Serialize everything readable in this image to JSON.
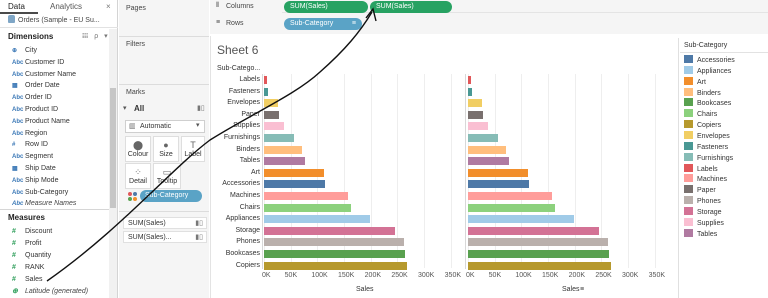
{
  "tabs": {
    "data": "Data",
    "analytics": "Analytics",
    "close": "×"
  },
  "datasource": "Orders (Sample - EU Su...",
  "dimensions": {
    "heading": "Dimensions",
    "tools": "𝍖 ρ ▾",
    "fields": [
      {
        "type": "⊕",
        "name": "City"
      },
      {
        "type": "Abc",
        "name": "Customer ID"
      },
      {
        "type": "Abc",
        "name": "Customer Name"
      },
      {
        "type": "▦",
        "name": "Order Date"
      },
      {
        "type": "Abc",
        "name": "Order ID"
      },
      {
        "type": "Abc",
        "name": "Product ID"
      },
      {
        "type": "Abc",
        "name": "Product Name"
      },
      {
        "type": "Abc",
        "name": "Region"
      },
      {
        "type": "#",
        "name": "Row ID"
      },
      {
        "type": "Abc",
        "name": "Segment"
      },
      {
        "type": "▦",
        "name": "Ship Date"
      },
      {
        "type": "Abc",
        "name": "Ship Mode"
      },
      {
        "type": "Abc",
        "name": "Sub-Category"
      },
      {
        "type": "Abc",
        "name": "Measure Names"
      }
    ]
  },
  "measures": {
    "heading": "Measures",
    "fields": [
      {
        "type": "#",
        "name": "Discount"
      },
      {
        "type": "#",
        "name": "Profit"
      },
      {
        "type": "#",
        "name": "Quantity"
      },
      {
        "type": "#",
        "name": "RANK"
      },
      {
        "type": "#",
        "name": "Sales"
      },
      {
        "type": "⊕",
        "name": "Latitude (generated)"
      }
    ]
  },
  "shelves": {
    "pages": "Pages",
    "filters": "Filters",
    "marks": "Marks",
    "marks_all": "All",
    "mark_type": "Automatic",
    "buttons": {
      "colour": "Colour",
      "size": "Size",
      "label": "Label",
      "detail": "Detail",
      "tooltip": "Tooltip"
    },
    "colour_pill": "Sub-Category",
    "sum_rows": [
      "SUM(Sales)",
      "SUM(Sales)..."
    ],
    "columns_label": "Columns",
    "rows_label": "Rows",
    "column_pills": [
      "SUM(Sales)",
      "SUM(Sales)"
    ],
    "row_pill": "Sub-Category"
  },
  "sheet": {
    "title": "Sheet 6",
    "row_header": "Sub-Catego...",
    "axis_title_left": "Sales",
    "axis_title_right": "Sales",
    "sort_icon": "≡"
  },
  "legend": {
    "title": "Sub-Category",
    "items": [
      {
        "name": "Accessories",
        "color": "#4e79a7"
      },
      {
        "name": "Appliances",
        "color": "#a0cbe8"
      },
      {
        "name": "Art",
        "color": "#f28e2b"
      },
      {
        "name": "Binders",
        "color": "#ffbe7d"
      },
      {
        "name": "Bookcases",
        "color": "#59a14f"
      },
      {
        "name": "Chairs",
        "color": "#8cd17d"
      },
      {
        "name": "Copiers",
        "color": "#b6992d"
      },
      {
        "name": "Envelopes",
        "color": "#f1ce63"
      },
      {
        "name": "Fasteners",
        "color": "#499894"
      },
      {
        "name": "Furnishings",
        "color": "#86bcb6"
      },
      {
        "name": "Labels",
        "color": "#e15759"
      },
      {
        "name": "Machines",
        "color": "#ff9d9a"
      },
      {
        "name": "Paper",
        "color": "#79706e"
      },
      {
        "name": "Phones",
        "color": "#bab0ac"
      },
      {
        "name": "Storage",
        "color": "#d37295"
      },
      {
        "name": "Supplies",
        "color": "#fabfd2"
      },
      {
        "name": "Tables",
        "color": "#b07aa1"
      }
    ]
  },
  "chart_data": {
    "type": "bar",
    "orientation": "horizontal",
    "panels": 2,
    "categories": [
      "Labels",
      "Fasteners",
      "Envelopes",
      "Paper",
      "Supplies",
      "Furnishings",
      "Binders",
      "Tables",
      "Art",
      "Accessories",
      "Machines",
      "Chairs",
      "Appliances",
      "Storage",
      "Phones",
      "Bookcases",
      "Copiers"
    ],
    "series": [
      {
        "name": "SUM(Sales)",
        "values": [
          6000,
          8000,
          27000,
          28000,
          37000,
          56000,
          72000,
          76000,
          112000,
          115000,
          157000,
          163000,
          198000,
          246000,
          262000,
          264000,
          268000
        ]
      },
      {
        "name": "SUM(Sales)",
        "values": [
          6000,
          8000,
          27000,
          28000,
          37000,
          56000,
          72000,
          76000,
          112000,
          115000,
          157000,
          163000,
          198000,
          246000,
          262000,
          264000,
          268000
        ]
      }
    ],
    "x_tick_labels": [
      "0K",
      "50K",
      "100K",
      "150K",
      "200K",
      "250K",
      "300K",
      "350K"
    ],
    "xlabel": "Sales",
    "xlim": [
      0,
      360000
    ],
    "grid": true,
    "legend_placement": "right"
  }
}
